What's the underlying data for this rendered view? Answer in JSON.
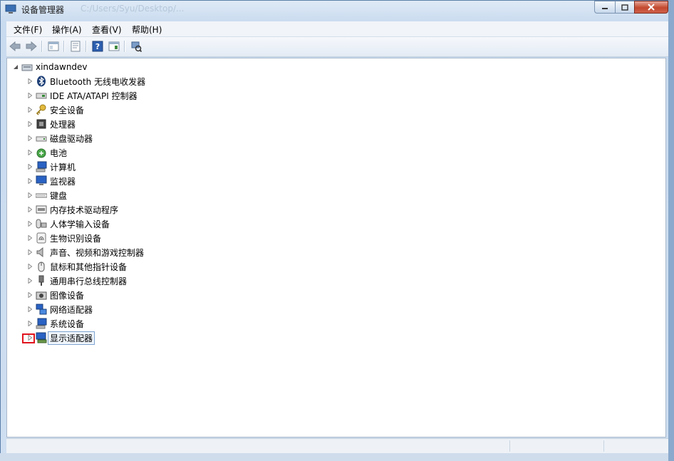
{
  "window": {
    "title": "设备管理器",
    "background_path": "C:/Users/Syu/Desktop/...",
    "controls": {
      "minimize": "—",
      "maximize": "□",
      "close": "✕"
    }
  },
  "menu": [
    {
      "label": "文件(F)"
    },
    {
      "label": "操作(A)"
    },
    {
      "label": "查看(V)"
    },
    {
      "label": "帮助(H)"
    }
  ],
  "toolbar": {
    "buttons": [
      "back-icon",
      "forward-icon",
      "show-hide-tree-icon",
      "properties-icon",
      "help-icon",
      "view-details-icon",
      "scan-hardware-icon"
    ]
  },
  "tree": {
    "root": {
      "label": "xindawndev",
      "icon": "computer-icon"
    },
    "items": [
      {
        "label": "Bluetooth 无线电收发器",
        "icon": "bluetooth-icon"
      },
      {
        "label": "IDE ATA/ATAPI 控制器",
        "icon": "ide-controller-icon"
      },
      {
        "label": "安全设备",
        "icon": "security-key-icon"
      },
      {
        "label": "处理器",
        "icon": "processor-icon"
      },
      {
        "label": "磁盘驱动器",
        "icon": "disk-drive-icon"
      },
      {
        "label": "电池",
        "icon": "battery-icon"
      },
      {
        "label": "计算机",
        "icon": "computer-icon"
      },
      {
        "label": "监视器",
        "icon": "monitor-icon"
      },
      {
        "label": "键盘",
        "icon": "keyboard-icon"
      },
      {
        "label": "内存技术驱动程序",
        "icon": "memory-icon"
      },
      {
        "label": "人体学输入设备",
        "icon": "hid-icon"
      },
      {
        "label": "生物识别设备",
        "icon": "fingerprint-icon"
      },
      {
        "label": "声音、视频和游戏控制器",
        "icon": "speaker-icon"
      },
      {
        "label": "鼠标和其他指针设备",
        "icon": "mouse-icon"
      },
      {
        "label": "通用串行总线控制器",
        "icon": "usb-icon"
      },
      {
        "label": "图像设备",
        "icon": "camera-icon"
      },
      {
        "label": "网络适配器",
        "icon": "network-icon"
      },
      {
        "label": "系统设备",
        "icon": "system-device-icon"
      },
      {
        "label": "显示适配器",
        "icon": "display-adapter-icon",
        "selected": true
      }
    ]
  }
}
